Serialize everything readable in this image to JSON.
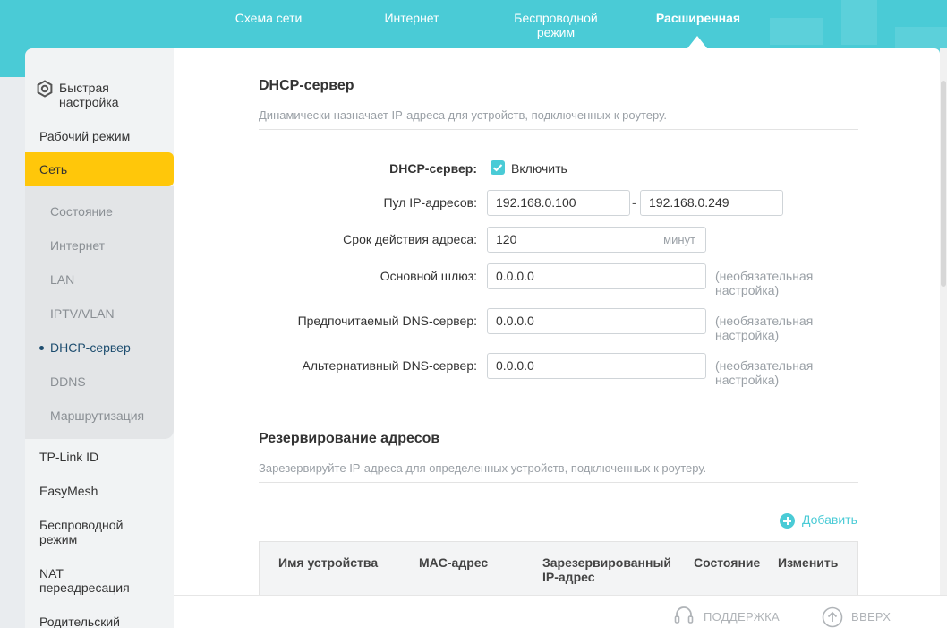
{
  "topnav": {
    "items": [
      {
        "label": "Схема сети"
      },
      {
        "label": "Интернет"
      },
      {
        "label": "Беспроводной режим"
      },
      {
        "label": "Расширенная"
      }
    ]
  },
  "sidebar": {
    "quick_setup": "Быстрая настройка",
    "items": [
      {
        "label": "Рабочий режим"
      },
      {
        "label": "Сеть"
      },
      {
        "label": "TP-Link ID"
      },
      {
        "label": "EasyMesh"
      },
      {
        "label": "Беспроводной режим"
      },
      {
        "label": "NAT переадресация"
      },
      {
        "label": "Родительский"
      }
    ],
    "sub_items": [
      {
        "label": "Состояние"
      },
      {
        "label": "Интернет"
      },
      {
        "label": "LAN"
      },
      {
        "label": "IPTV/VLAN"
      },
      {
        "label": "DHCP-сервер"
      },
      {
        "label": "DDNS"
      },
      {
        "label": "Маршрутизация"
      }
    ]
  },
  "dhcp": {
    "title": "DHCP-сервер",
    "description": "Динамически назначает IP-адреса для устройств, подключенных к роутеру.",
    "server_label": "DHCP-сервер:",
    "enable_label": "Включить",
    "enabled": true,
    "pool_label": "Пул IP-адресов:",
    "pool_start": "192.168.0.100",
    "pool_end": "192.168.0.249",
    "lease_label": "Срок действия адреса:",
    "lease_value": "120",
    "lease_unit": "минут",
    "gateway_label": "Основной шлюз:",
    "gateway_value": "0.0.0.0",
    "dns1_label": "Предпочитаемый DNS-сервер:",
    "dns1_value": "0.0.0.0",
    "dns2_label": "Альтернативный DNS-сервер:",
    "dns2_value": "0.0.0.0",
    "optional_hint": "(необязательная настройка)"
  },
  "reservation": {
    "title": "Резервирование адресов",
    "description": "Зарезервируйте IP-адреса для определенных устройств, подключенных к роутеру.",
    "add_label": "Добавить",
    "columns": [
      "Имя устройства",
      "MAC-адрес",
      "Зарезервированный IP-адрес",
      "Состояние",
      "Изменить"
    ]
  },
  "footer": {
    "support": "ПОДДЕРЖКА",
    "top": "ВВЕРХ"
  },
  "colors": {
    "accent": "#4acbd6",
    "active_menu": "#ffc70a"
  }
}
